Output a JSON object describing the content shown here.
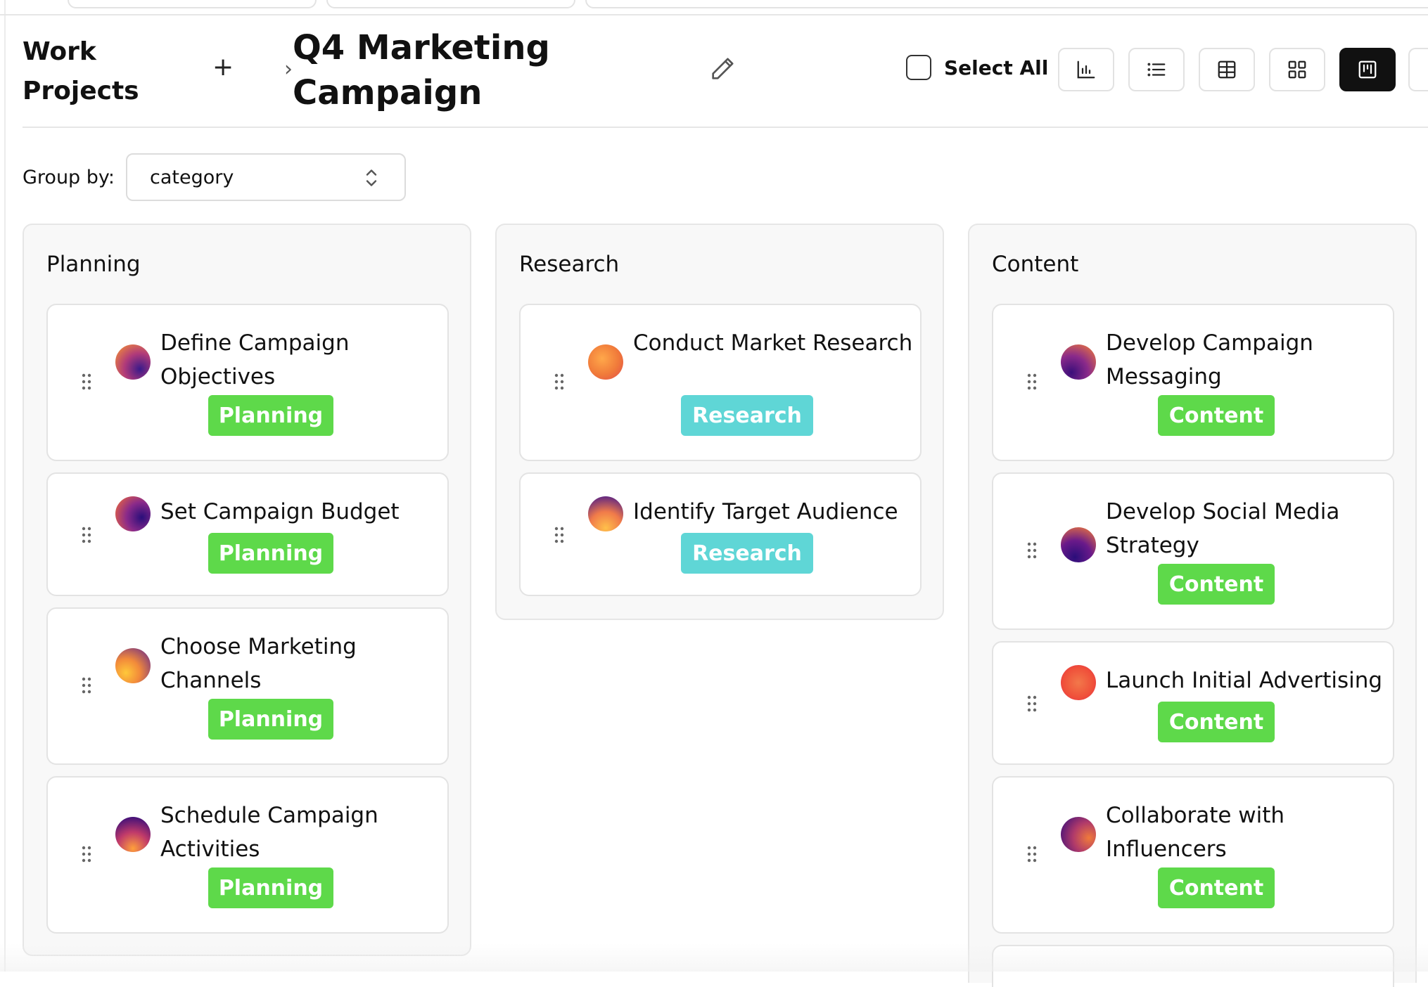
{
  "header": {
    "breadcrumb_root": "Work Projects",
    "add_symbol": "+",
    "chevron": "›",
    "page_title": "Q4 Marketing Campaign",
    "select_all_label": "Select All",
    "view_buttons": [
      {
        "name": "chart-view",
        "icon": "bar-chart-icon",
        "active": false
      },
      {
        "name": "list-view",
        "icon": "list-icon",
        "active": false
      },
      {
        "name": "table-view",
        "icon": "table-icon",
        "active": false
      },
      {
        "name": "grid-view",
        "icon": "grid-icon",
        "active": false
      },
      {
        "name": "board-view",
        "icon": "kanban-icon",
        "active": true
      }
    ]
  },
  "group_by": {
    "label": "Group by:",
    "value": "category"
  },
  "colors": {
    "planning_tag": "#5ed94a",
    "content_tag": "#5ed94a",
    "research_tag": "#5fd6d6",
    "active_view": "#111111"
  },
  "columns": [
    {
      "title": "Planning",
      "cards": [
        {
          "title": "Define Campaign Objectives",
          "tag": "Planning"
        },
        {
          "title": "Set Campaign Budget",
          "tag": "Planning"
        },
        {
          "title": "Choose Marketing Channels",
          "tag": "Planning"
        },
        {
          "title": "Schedule Campaign Activities",
          "tag": "Planning"
        }
      ]
    },
    {
      "title": "Research",
      "cards": [
        {
          "title": "Conduct Market Research",
          "tag": "Research"
        },
        {
          "title": "Identify Target Audience",
          "tag": "Research"
        }
      ]
    },
    {
      "title": "Content",
      "cards": [
        {
          "title": "Develop Campaign Messaging",
          "tag": "Content"
        },
        {
          "title": "Develop Social Media Strategy",
          "tag": "Content"
        },
        {
          "title": "Launch Initial Advertising",
          "tag": "Content"
        },
        {
          "title": "Collaborate with Influencers",
          "tag": "Content"
        }
      ]
    }
  ]
}
